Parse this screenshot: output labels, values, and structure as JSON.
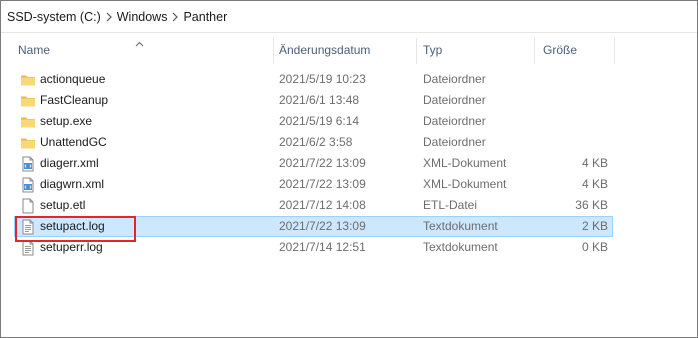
{
  "breadcrumb": [
    "SSD-system (C:)",
    "Windows",
    "Panther"
  ],
  "columns": {
    "name": "Name",
    "date": "Änderungsdatum",
    "type": "Typ",
    "size": "Größe"
  },
  "files": [
    {
      "name": "actionqueue",
      "date": "2021/5/19 10:23",
      "type": "Dateiordner",
      "size": "",
      "icon": "folder-icon",
      "selected": false
    },
    {
      "name": "FastCleanup",
      "date": "2021/6/1 13:48",
      "type": "Dateiordner",
      "size": "",
      "icon": "folder-icon",
      "selected": false
    },
    {
      "name": "setup.exe",
      "date": "2021/5/19 6:14",
      "type": "Dateiordner",
      "size": "",
      "icon": "folder-icon",
      "selected": false
    },
    {
      "name": "UnattendGC",
      "date": "2021/6/2 3:58",
      "type": "Dateiordner",
      "size": "",
      "icon": "folder-icon",
      "selected": false
    },
    {
      "name": "diagerr.xml",
      "date": "2021/7/22 13:09",
      "type": "XML-Dokument",
      "size": "4 KB",
      "icon": "xml-file-icon",
      "selected": false
    },
    {
      "name": "diagwrn.xml",
      "date": "2021/7/22 13:09",
      "type": "XML-Dokument",
      "size": "4 KB",
      "icon": "xml-file-icon",
      "selected": false
    },
    {
      "name": "setup.etl",
      "date": "2021/7/12 14:08",
      "type": "ETL-Datei",
      "size": "36 KB",
      "icon": "blank-file-icon",
      "selected": false
    },
    {
      "name": "setupact.log",
      "date": "2021/7/22 13:09",
      "type": "Textdokument",
      "size": "2 KB",
      "icon": "text-file-icon",
      "selected": true
    },
    {
      "name": "setuperr.log",
      "date": "2021/7/14 12:51",
      "type": "Textdokument",
      "size": "0 KB",
      "icon": "text-file-icon",
      "selected": false
    }
  ],
  "colors": {
    "selection": "#cce8ff",
    "selection_border": "#99d1ff",
    "highlight": "#e0282c",
    "folder": "#f8d775"
  }
}
